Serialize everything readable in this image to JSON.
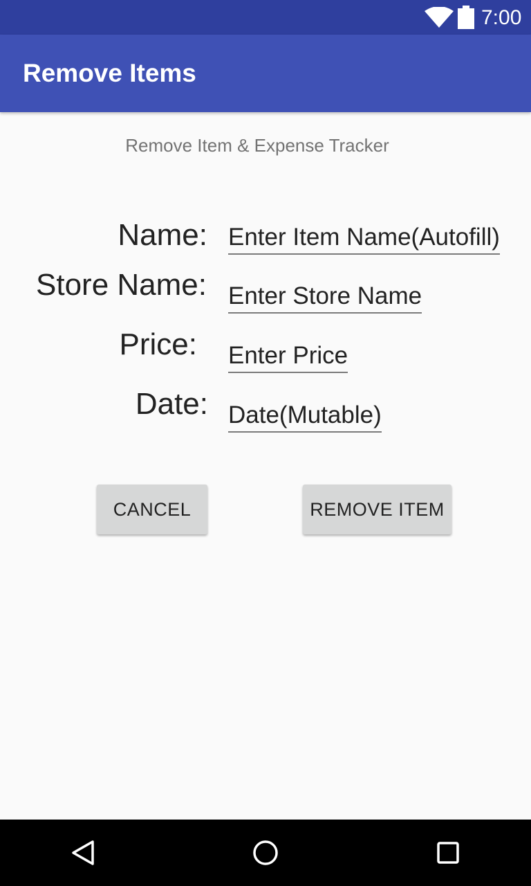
{
  "status_bar": {
    "time": "7:00",
    "icons": [
      "wifi-icon",
      "battery-icon"
    ]
  },
  "app_bar": {
    "title": "Remove Items"
  },
  "subtitle": "Remove Item & Expense Tracker",
  "form": {
    "name_label": "Name:",
    "name_placeholder": "Enter Item Name(Autofill)",
    "store_label": "Store Name:",
    "store_placeholder": "Enter Store Name",
    "price_label": "Price:",
    "price_placeholder": "Enter Price",
    "date_label": "Date:",
    "date_placeholder": "Date(Mutable)"
  },
  "buttons": {
    "cancel": "CANCEL",
    "remove": "REMOVE ITEM"
  },
  "nav_bar": {
    "icons": [
      "back-icon",
      "home-icon",
      "recents-icon"
    ]
  },
  "colors": {
    "status_bar": "#2f3f9e",
    "app_bar": "#3f51b5",
    "background": "#fafafa",
    "button": "#d6d7d7"
  }
}
